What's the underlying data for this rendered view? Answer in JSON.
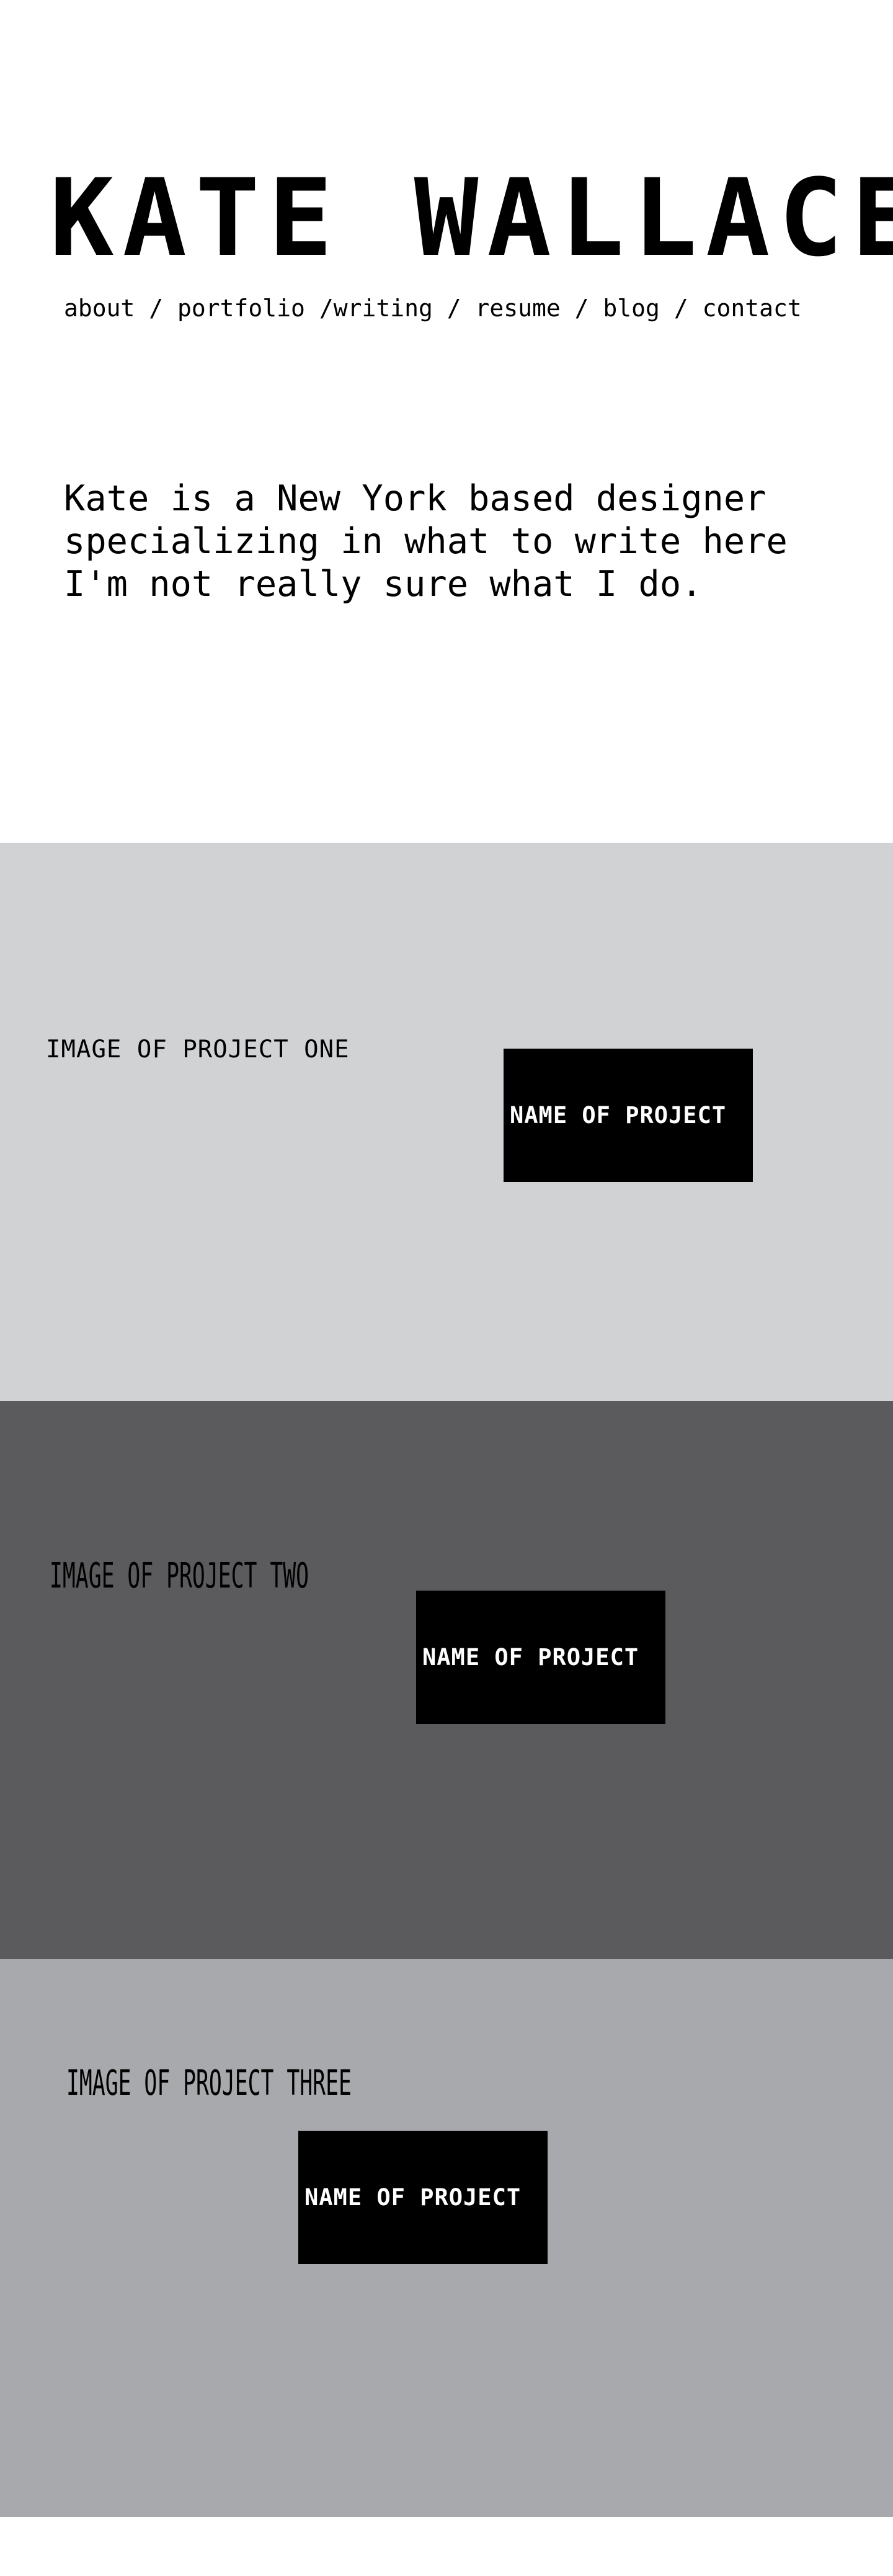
{
  "header": {
    "title": "KATE WALLACE"
  },
  "nav": {
    "items": [
      {
        "label": "about"
      },
      {
        "label": "portfolio"
      },
      {
        "label": "writing"
      },
      {
        "label": "resume"
      },
      {
        "label": "blog"
      },
      {
        "label": "contact"
      }
    ],
    "separator": " / "
  },
  "intro": {
    "text": "Kate is a New York based designer specializing in what to write here I'm not really sure what I do."
  },
  "projects": [
    {
      "image_label": "IMAGE OF PROJECT ONE",
      "name_label": "NAME OF PROJECT",
      "background_color": "#d1d2d4"
    },
    {
      "image_label": "IMAGE OF PROJECT TWO",
      "name_label": "NAME OF PROJECT",
      "background_color": "#5b5b5d"
    },
    {
      "image_label": "IMAGE OF PROJECT THREE",
      "name_label": "NAME OF PROJECT",
      "background_color": "#a8a9ac"
    }
  ],
  "colors": {
    "page_background": "#ffffff",
    "text": "#000000",
    "project_name_box": "#000000",
    "project_name_text": "#ffffff"
  }
}
